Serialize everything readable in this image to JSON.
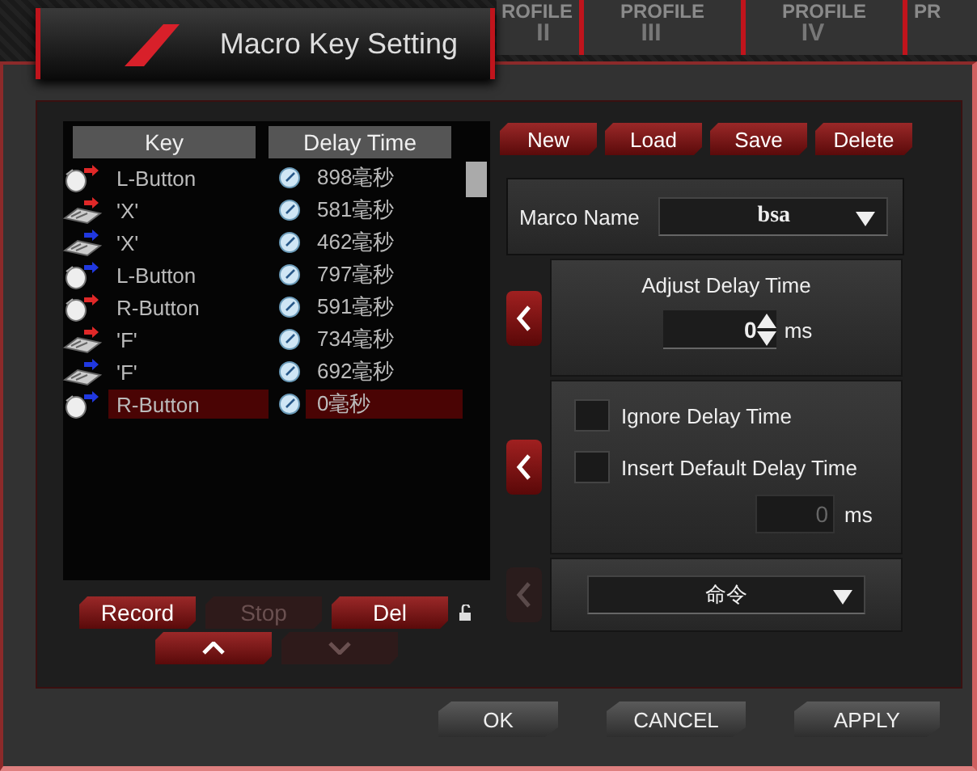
{
  "title": "Macro Key Setting",
  "profile_tabs": [
    {
      "label": "ROFILE",
      "number": "II"
    },
    {
      "label": "PROFILE",
      "number": "III"
    },
    {
      "label": "PROFILE",
      "number": "IV"
    },
    {
      "label": "PR"
    }
  ],
  "macro_list": {
    "columns": [
      "Key",
      "Delay Time"
    ],
    "rows": [
      {
        "kind": "mouse",
        "color": "#e02828",
        "key": "L-Button",
        "delay": "898毫秒",
        "selected": false
      },
      {
        "kind": "keyboard",
        "color": "#e02828",
        "key": "'X'",
        "delay": "581毫秒",
        "selected": false
      },
      {
        "kind": "keyboard",
        "color": "#2038e0",
        "key": "'X'",
        "delay": "462毫秒",
        "selected": false
      },
      {
        "kind": "mouse",
        "color": "#2038e0",
        "key": "L-Button",
        "delay": "797毫秒",
        "selected": false
      },
      {
        "kind": "mouse",
        "color": "#e02828",
        "key": "R-Button",
        "delay": "591毫秒",
        "selected": false
      },
      {
        "kind": "keyboard",
        "color": "#e02828",
        "key": "'F'",
        "delay": "734毫秒",
        "selected": false
      },
      {
        "kind": "keyboard",
        "color": "#2038e0",
        "key": "'F'",
        "delay": "692毫秒",
        "selected": false
      },
      {
        "kind": "mouse",
        "color": "#2038e0",
        "key": "R-Button",
        "delay": "0毫秒",
        "selected": true
      }
    ]
  },
  "list_buttons": [
    {
      "label": "Record",
      "disabled": false
    },
    {
      "label": "Stop",
      "disabled": true
    },
    {
      "label": "Del",
      "disabled": false
    }
  ],
  "move_buttons": [
    {
      "kind": "up",
      "disabled": false
    },
    {
      "kind": "down",
      "disabled": true
    }
  ],
  "file_buttons": [
    "New",
    "Load",
    "Save",
    "Delete"
  ],
  "macro_name": {
    "label": "Marco Name",
    "value": "bsa"
  },
  "adjust_delay": {
    "title": "Adjust Delay Time",
    "value": "0",
    "unit": "ms",
    "apply_disabled": false
  },
  "delay_options": {
    "apply_disabled": false,
    "checks": [
      {
        "label": "Ignore Delay Time",
        "checked": false
      },
      {
        "label": "Insert Default Delay Time",
        "checked": false
      }
    ],
    "default_value": "0",
    "unit": "ms"
  },
  "command": {
    "value": "命令",
    "apply_disabled": true
  },
  "dialog_buttons": [
    "OK",
    "CANCEL",
    "APPLY"
  ]
}
